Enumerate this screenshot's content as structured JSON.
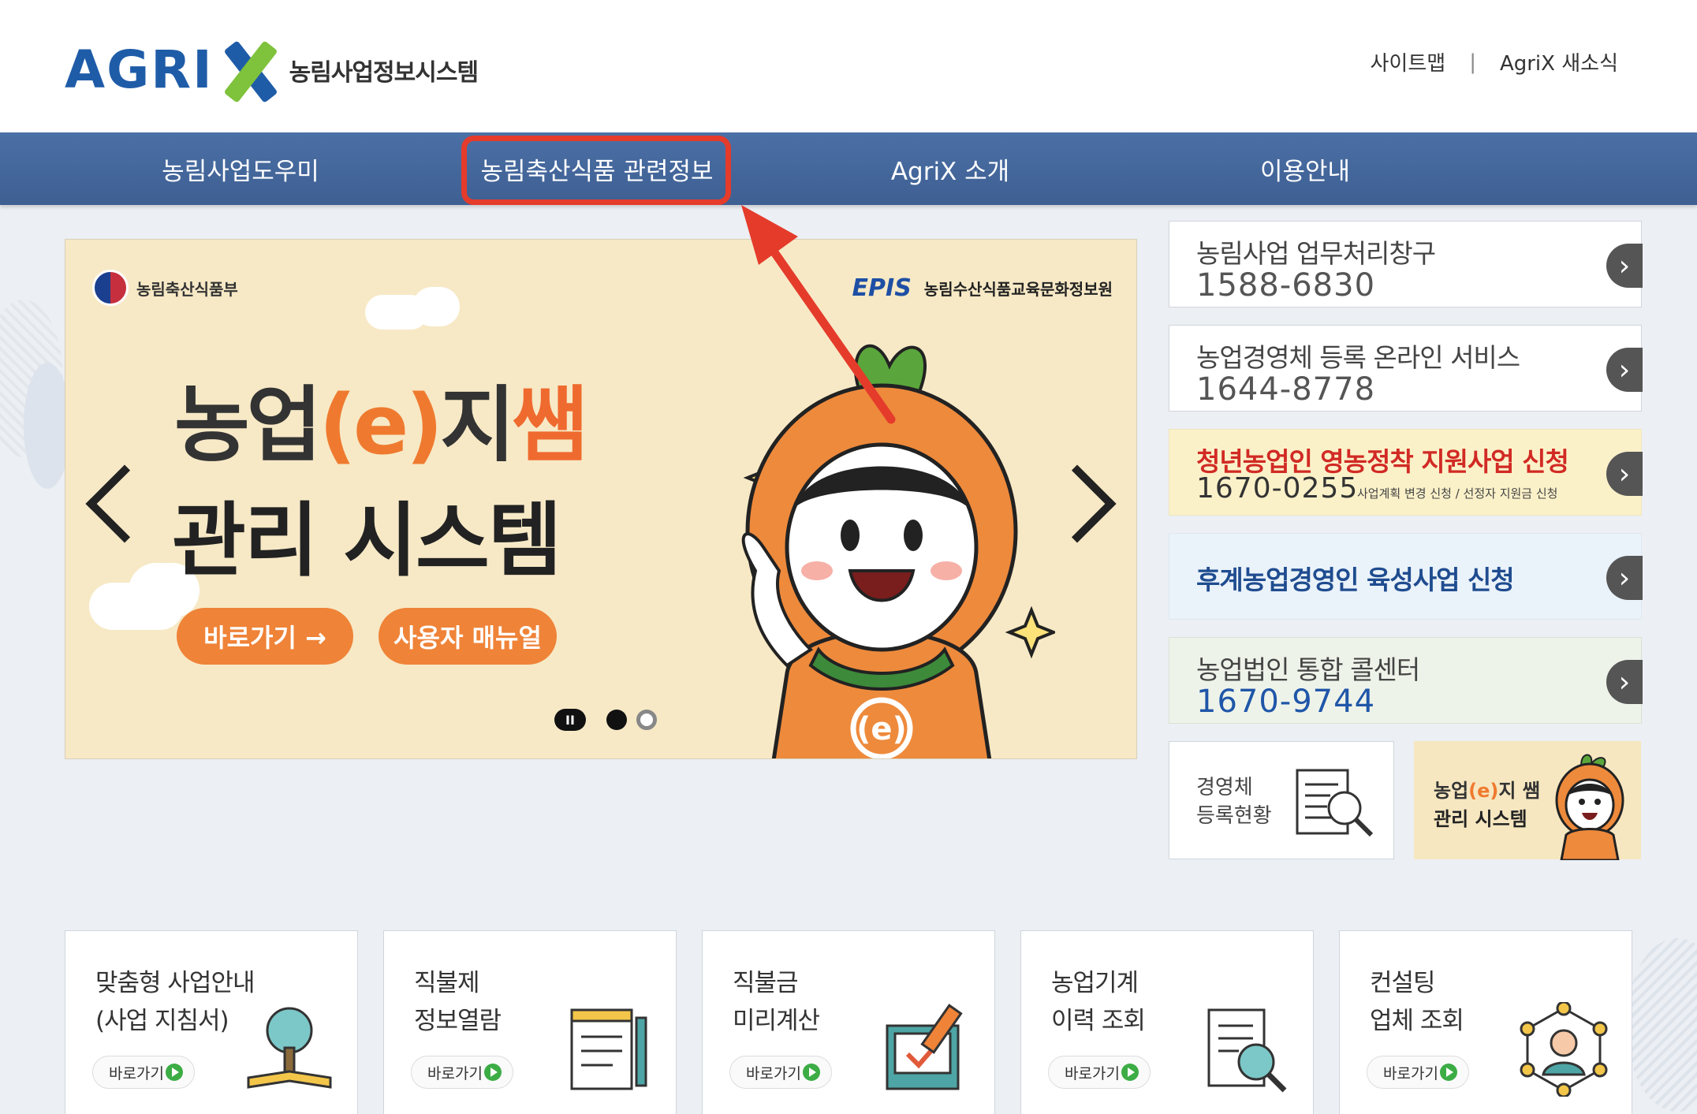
{
  "header": {
    "logo_text": "AGRI",
    "logo_sub": "농림사업정보시스템",
    "links": [
      "사이트맵",
      "AgriX 새소식"
    ],
    "sep": "|"
  },
  "nav": {
    "items": [
      "농림사업도우미",
      "농림축산식품 관련정보",
      "AgriX 소개",
      "이용안내"
    ],
    "highlighted_index": 1,
    "highlight_color": "#e53b2b"
  },
  "banner": {
    "ministry": "농림축산식품부",
    "epis_logo": "EPIS",
    "epis_name": "농림수산식품교육문화정보원",
    "title_a": "농업",
    "title_e": "(e)",
    "title_b": "지",
    "title_ssam": "쌤",
    "title2": "관리 시스템",
    "btn_go": "바로가기 →",
    "btn_manual": "사용자 매뉴얼",
    "pause": "II",
    "mascot_badge": "(e)"
  },
  "side": [
    {
      "title": "농림사업 업무처리창구",
      "number": "1588-6830"
    },
    {
      "title": "농업경영체 등록 온라인 서비스",
      "number": "1644-8778"
    },
    {
      "title": "청년농업인 영농정착 지원사업 신청",
      "number": "1670-0255",
      "note": "사업계획 변경 신청 / 선정자 지원금 신청"
    },
    {
      "title": "후계농업경영인 육성사업 신청"
    },
    {
      "title": "농업법인 통합 콜센터",
      "number": "1670-9744"
    }
  ],
  "side_go": "›",
  "tiles": {
    "t1_line1": "경영체",
    "t1_line2": "등록현황",
    "t2_a": "농업",
    "t2_e": "(e)",
    "t2_b": "지 쌤",
    "t2_line2": "관리 시스템"
  },
  "cards": [
    {
      "line1": "맞춤형 사업안내",
      "line2": "(사업 지침서)",
      "icon": "tree-book-icon"
    },
    {
      "line1": "직불제",
      "line2": "정보열람",
      "icon": "notepad-icon"
    },
    {
      "line1": "직불금",
      "line2": "미리계산",
      "icon": "calculator-check-icon"
    },
    {
      "line1": "농업기계",
      "line2": "이력 조회",
      "icon": "document-search-icon"
    },
    {
      "line1": "컨설팅",
      "line2": "업체 조회",
      "icon": "network-person-icon"
    }
  ],
  "card_go": "바로가기",
  "colors": {
    "nav_bg": "#4467a0",
    "accent_orange": "#ef8338",
    "brand_blue": "#1f5ca8",
    "brand_green": "#7fc23c",
    "annotation_red": "#e53b2b"
  }
}
